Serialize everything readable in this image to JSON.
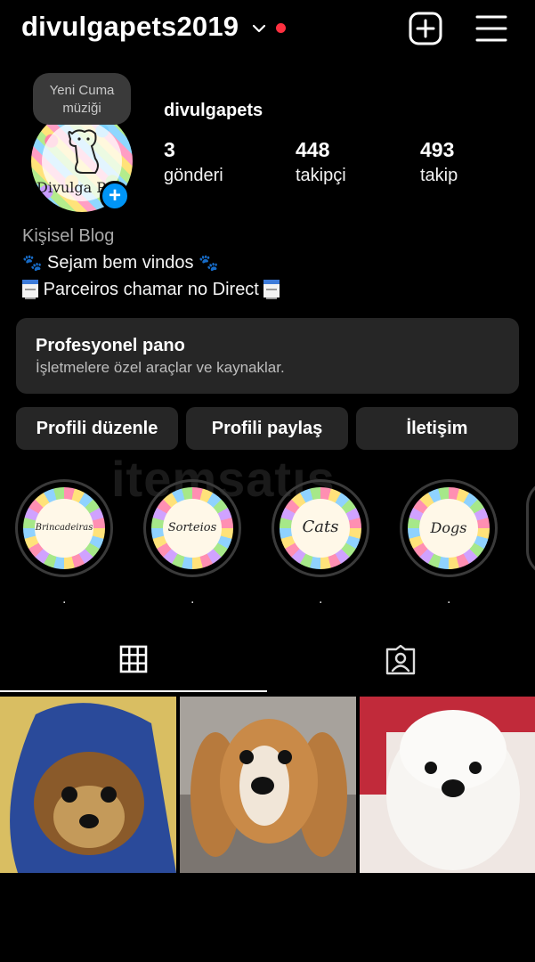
{
  "header": {
    "username": "divulgapets2019"
  },
  "profile": {
    "note": "Yeni Cuma müziği",
    "avatar_text": "Divulga Pe",
    "display_name": "divulgapets",
    "stats": [
      {
        "value": "3",
        "label": "gönderi"
      },
      {
        "value": "448",
        "label": "takipçi"
      },
      {
        "value": "493",
        "label": "takip"
      }
    ],
    "bio_category": "Kişisel Blog",
    "bio_line1": "Sejam bem vindos",
    "bio_line2": "Parceiros chamar no Direct"
  },
  "dashboard": {
    "title": "Profesyonel pano",
    "subtitle": "İşletmelere özel araçlar ve kaynaklar."
  },
  "buttons": {
    "edit": "Profili düzenle",
    "share": "Profili paylaş",
    "contact": "İletişim"
  },
  "watermark": "itemsatış",
  "highlights": [
    {
      "text": "Brincadeiras",
      "caption": "."
    },
    {
      "text": "Sorteios",
      "caption": "."
    },
    {
      "text": "Cats",
      "caption": "."
    },
    {
      "text": "Dogs",
      "caption": "."
    }
  ],
  "icons": {
    "add": "plus-square-icon",
    "menu": "hamburger-menu-icon",
    "grid": "grid-icon",
    "tagged": "tagged-person-icon",
    "chevron": "chevron-down-icon"
  },
  "colors": {
    "background": "#000000",
    "surface": "#262626",
    "accent_blue": "#0095f6",
    "notification_red": "#ff3040"
  }
}
